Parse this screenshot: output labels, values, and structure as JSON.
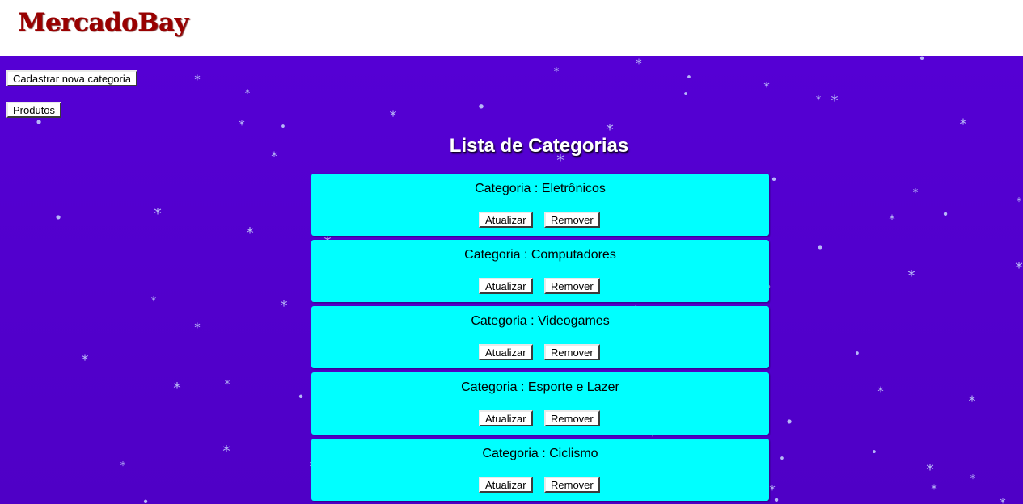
{
  "app": {
    "brand": "MercadoBay",
    "brand_color": "#990000",
    "background_color": "#5500d4",
    "card_color": "#00ffff"
  },
  "toolbar": {
    "new_category_label": "Cadastrar nova categoria",
    "products_label": "Produtos"
  },
  "main": {
    "title": "Lista de Categorias",
    "category_prefix": "Categoria : ",
    "update_label": "Atualizar",
    "remove_label": "Remover",
    "categories": [
      {
        "name": "Eletrônicos"
      },
      {
        "name": "Computadores"
      },
      {
        "name": "Videogames"
      },
      {
        "name": "Esporte e Lazer"
      },
      {
        "name": "Ciclismo"
      }
    ]
  }
}
